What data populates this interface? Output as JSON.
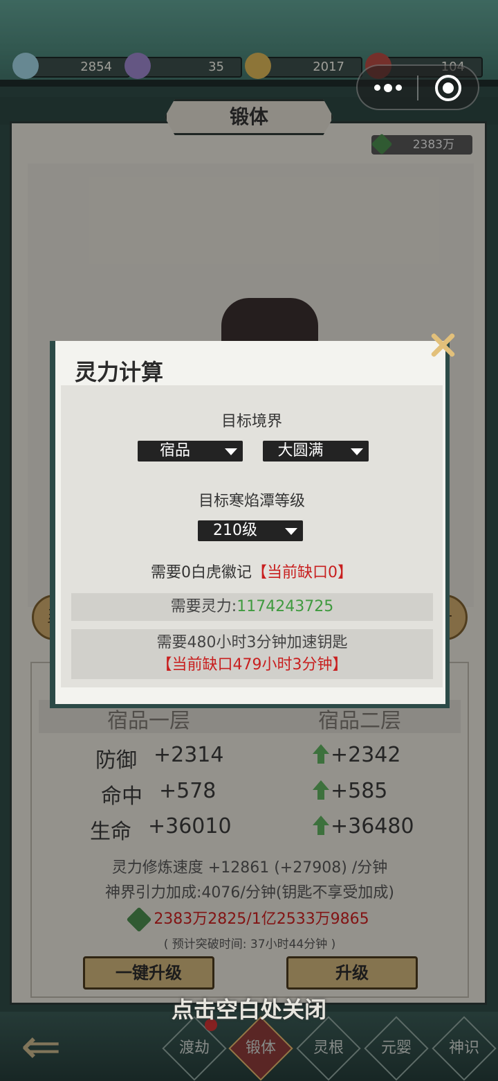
{
  "resources": [
    {
      "icon": "spirit-beast-icon",
      "value": "2854"
    },
    {
      "icon": "purple-spirit-icon",
      "value": "35"
    },
    {
      "icon": "gold-spirit-icon",
      "value": "2017"
    },
    {
      "icon": "red-spirit-icon",
      "value": "104"
    }
  ],
  "panel": {
    "title": "锻体",
    "stone_value": "2383万",
    "current_level": "宿品一层",
    "next_level": "宿品二层",
    "stats": [
      {
        "name": "防御",
        "current": "+2314",
        "next": "+2342"
      },
      {
        "name": "命中",
        "current": "+578",
        "next": "+585"
      },
      {
        "name": "生命",
        "current": "+36010",
        "next": "+36480"
      }
    ],
    "speed_line": "灵力修炼速度  +12861 (+27908) /分钟",
    "bonus_line": "神界引力加成:4076/分钟(钥匙不享受加成)",
    "progress_line": "2383万2825/1亿2533万9865",
    "estimate_line": "(  预计突破时间: 37小时44分钟  )",
    "one_key_btn": "一键升级",
    "upgrade_btn": "升级",
    "close_hint": "点击空白处关闭",
    "side_left": "灵",
    "side_right": "丹"
  },
  "dialog": {
    "title": "灵力计算",
    "target_realm_label": "目标境界",
    "realm_select": "宿品",
    "stage_select": "大圆满",
    "target_pool_label": "目标寒焰潭等级",
    "pool_select": "210级",
    "badge_need": "需要0白虎徽记",
    "badge_gap": "【当前缺口0】",
    "power_label": "需要灵力:",
    "power_value": "1174243725",
    "key_need": "需要480小时3分钟加速钥匙",
    "key_gap": "【当前缺口479小时3分钟】"
  },
  "nav": {
    "items": [
      "渡劫",
      "锻体",
      "灵根",
      "元婴",
      "神识"
    ],
    "active": "锻体"
  },
  "colors": {
    "accent_red": "#c81f1f",
    "accent_green": "#3f9a3f",
    "frame": "#2c4a47"
  }
}
